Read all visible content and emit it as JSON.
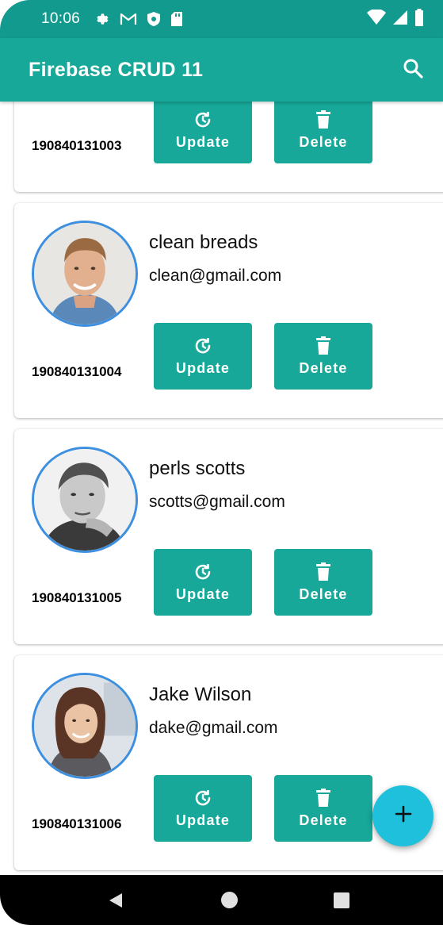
{
  "status_bar": {
    "time": "10:06"
  },
  "app_bar": {
    "title": "Firebase CRUD 11"
  },
  "cards": [
    {
      "name": "",
      "email": "",
      "roll": "190840131003",
      "update_label": "Update",
      "delete_label": "Delete"
    },
    {
      "name": "clean breads",
      "email": "clean@gmail.com",
      "roll": "190840131004",
      "update_label": "Update",
      "delete_label": "Delete"
    },
    {
      "name": "perls scotts",
      "email": "scotts@gmail.com",
      "roll": "190840131005",
      "update_label": "Update",
      "delete_label": "Delete"
    },
    {
      "name": "Jake Wilson",
      "email": "dake@gmail.com",
      "roll": "190840131006",
      "update_label": "Update",
      "delete_label": "Delete"
    }
  ],
  "fab": {
    "symbol": "+"
  },
  "colors": {
    "primary": "#17a899",
    "status": "#139a8e",
    "fab": "#1fc0dc",
    "avatar_ring": "#3d8fe0"
  }
}
